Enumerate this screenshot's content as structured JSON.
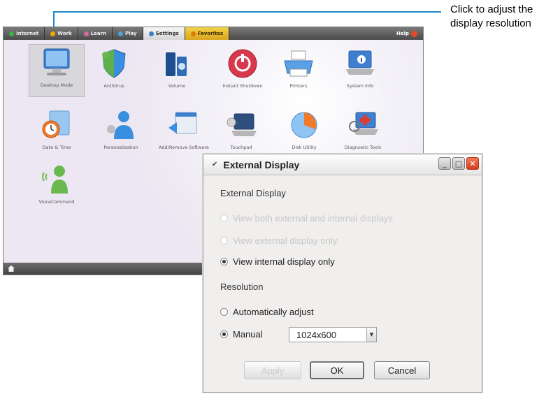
{
  "callout": {
    "text": "Click to adjust the display resolution",
    "color": "#1e88c8"
  },
  "tabs": [
    {
      "label": "Internet",
      "color": "#3bb54a"
    },
    {
      "label": "Work",
      "color": "#f2a900"
    },
    {
      "label": "Learn",
      "color": "#d66ba0"
    },
    {
      "label": "Play",
      "color": "#4aa3df"
    },
    {
      "label": "Settings",
      "color": "#3b7fd0"
    },
    {
      "label": "Favorites",
      "color": "#e07b00"
    }
  ],
  "help_label": "Help",
  "apps": [
    {
      "label": "Desktop Mode",
      "icon": "desktop-mode-icon"
    },
    {
      "label": "AntiVirus",
      "icon": "antivirus-icon"
    },
    {
      "label": "Volume",
      "icon": "volume-icon"
    },
    {
      "label": "Instant Shutdown",
      "icon": "instant-shutdown-icon"
    },
    {
      "label": "Printers",
      "icon": "printer-icon"
    },
    {
      "label": "System Info",
      "icon": "system-info-icon"
    },
    {
      "label": "Date & Time",
      "icon": "date-time-icon"
    },
    {
      "label": "Personalization",
      "icon": "personalization-icon"
    },
    {
      "label": "Add/Remove Software",
      "icon": "add-remove-software-icon"
    },
    {
      "label": "Touchpad",
      "icon": "touchpad-icon"
    },
    {
      "label": "Disk Utility",
      "icon": "disk-utility-icon"
    },
    {
      "label": "Diagnostic Tools",
      "icon": "diagnostic-tools-icon"
    },
    {
      "label": "VoiceCommand",
      "icon": "voice-command-icon"
    }
  ],
  "dialog": {
    "title": "External Display",
    "section1": "External Display",
    "opt_both": "View both external and internal displays",
    "opt_external": "View external display only",
    "opt_internal": "View internal display only",
    "section2": "Resolution",
    "opt_auto": "Automatically adjust",
    "opt_manual": "Manual",
    "resolution": "1024x600",
    "apply": "Apply",
    "ok": "OK",
    "cancel": "Cancel"
  }
}
